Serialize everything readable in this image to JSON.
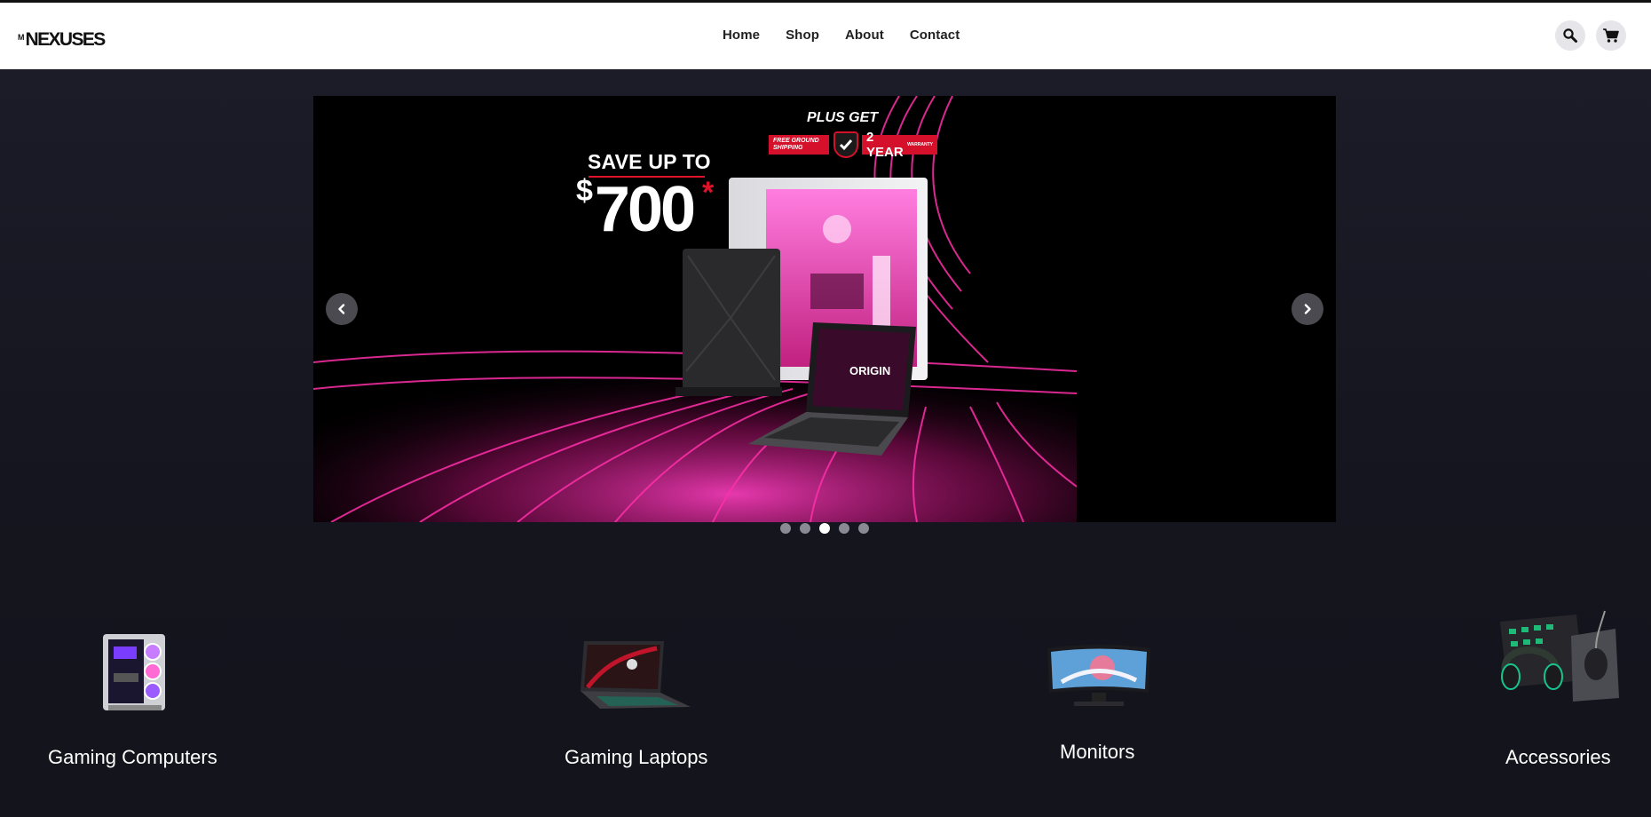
{
  "brand": {
    "name": "NEXUSES",
    "mark": "M"
  },
  "nav": {
    "items": [
      {
        "label": "Home"
      },
      {
        "label": "Shop"
      },
      {
        "label": "About"
      },
      {
        "label": "Contact"
      }
    ]
  },
  "header_icons": {
    "search": "search-icon",
    "cart": "cart-icon"
  },
  "hero": {
    "plus_get": "PLUS GET",
    "shipping_badge_line1": "FREE GROUND",
    "shipping_badge_line2": "SHIPPING",
    "warranty_badge": "2 YEAR",
    "warranty_badge_small": "WARRANTY",
    "save_text": "SAVE UP TO",
    "currency": "$",
    "amount": "700",
    "asterisk": "*",
    "laptop_logo": "ORIGIN",
    "accent_color": "#ff1fa8",
    "slide_count": 5,
    "active_slide": 3
  },
  "categories": [
    {
      "label": "Gaming Computers"
    },
    {
      "label": "Gaming Laptops"
    },
    {
      "label": "Monitors"
    },
    {
      "label": "Accessories"
    }
  ]
}
